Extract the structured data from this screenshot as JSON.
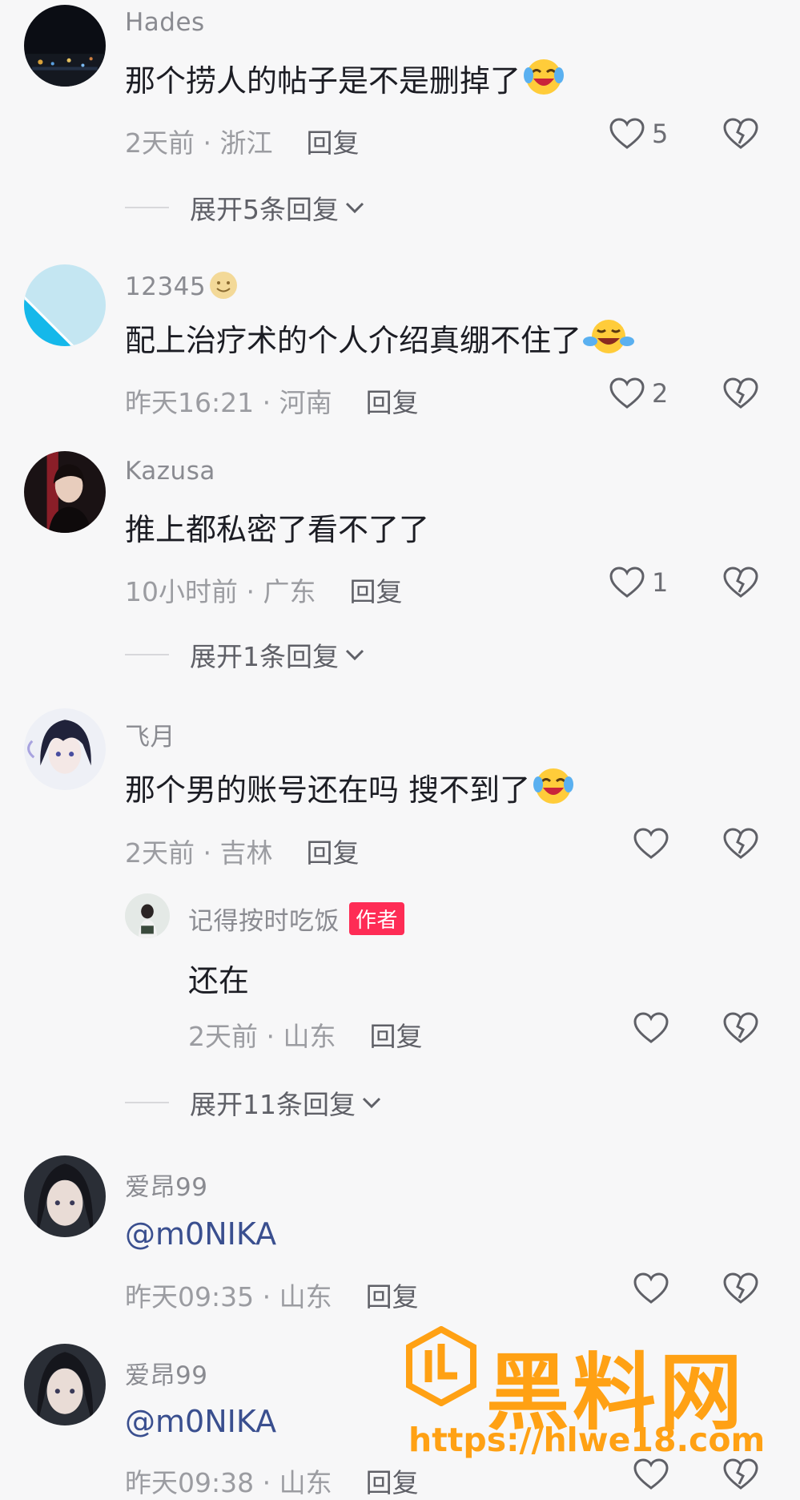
{
  "comments": [
    {
      "username": "Hades",
      "text": "那个捞人的帖子是不是删掉了",
      "emoji": "crying-laughing",
      "time_location": "2天前 · 浙江",
      "reply_label": "回复",
      "like_count": "5",
      "expand_label": "展开5条回复"
    },
    {
      "username": "12345",
      "username_emoji": "smile",
      "text": "配上治疗术的个人介绍真绷不住了",
      "emoji": "tears-of-joy",
      "time_location": "昨天16:21 · 河南",
      "reply_label": "回复",
      "like_count": "2"
    },
    {
      "username": "Kazusa",
      "text": "推上都私密了看不了了",
      "time_location": "10小时前 · 广东",
      "reply_label": "回复",
      "like_count": "1",
      "expand_label": "展开1条回复"
    },
    {
      "username": "飞月",
      "text": "那个男的账号还在吗 搜不到了",
      "emoji": "crying-laughing",
      "time_location": "2天前 · 吉林",
      "reply_label": "回复",
      "reply": {
        "username": "记得按时吃饭",
        "badge": "作者",
        "text": "还在",
        "time_location": "2天前 · 山东",
        "reply_label": "回复"
      },
      "expand_label": "展开11条回复"
    },
    {
      "username": "爱昂99",
      "text": "@m0NIKA",
      "time_location": "昨天09:35 · 山东",
      "reply_label": "回复"
    },
    {
      "username": "爱昂99",
      "text": "@m0NIKA",
      "time_location": "昨天09:38 · 山东",
      "reply_label": "回复"
    }
  ],
  "watermark": {
    "title": "黑料网",
    "url": "https://hlwe18.com"
  },
  "colors": {
    "accent_red": "#fe2c55",
    "watermark_orange": "#ffa114",
    "mention_blue": "#3a4f8f"
  }
}
